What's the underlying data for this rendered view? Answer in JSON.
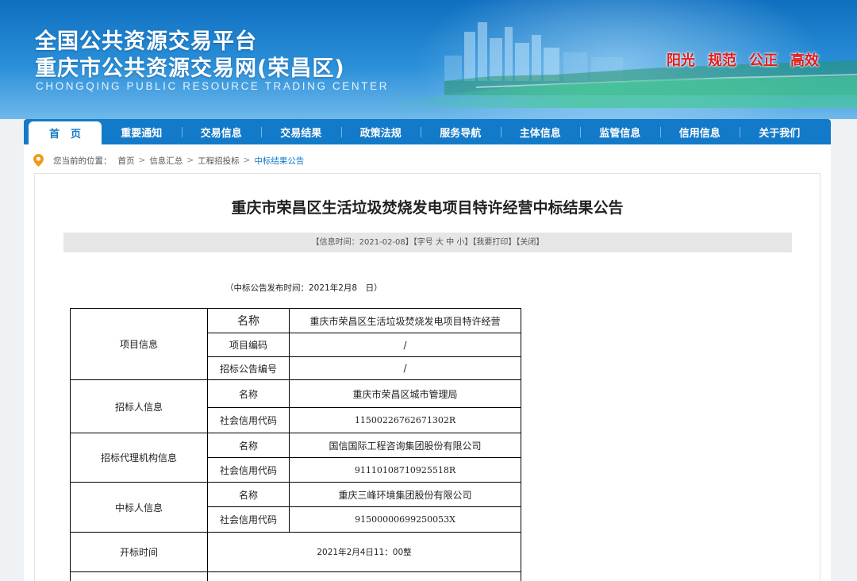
{
  "header": {
    "title_line1": "全国公共资源交易平台",
    "title_line2": "重庆市公共资源交易网(荣昌区)",
    "title_en": "CHONGQING PUBLIC RESOURCE TRADING CENTER",
    "slogans": [
      "阳光",
      "规范",
      "公正",
      "高效"
    ]
  },
  "nav": {
    "items": [
      "首页",
      "重要通知",
      "交易信息",
      "交易结果",
      "政策法规",
      "服务导航",
      "主体信息",
      "监管信息",
      "信用信息",
      "关于我们"
    ]
  },
  "breadcrumb": {
    "prefix": "您当前的位置：",
    "items": [
      "首页",
      "信息汇总",
      "工程招投标",
      "中标结果公告"
    ]
  },
  "article": {
    "title": "重庆市荣昌区生活垃圾焚烧发电项目特许经营中标结果公告",
    "info_time": "【信息时间：2021-02-08】",
    "font_size_label": "【字号",
    "font_large": "大",
    "font_medium": "中",
    "font_small": "小】",
    "print": "【我要打印】",
    "close": "【关闭】",
    "publish_time": "（中标公告发布时间：2021年2月8　日）"
  },
  "table": {
    "project_info": "项目信息",
    "name_label": "名称",
    "project_name": "重庆市荣昌区生活垃圾焚烧发电项目特许经营",
    "project_code_label": "项目编码",
    "project_code": "/",
    "bid_notice_no_label": "招标公告编号",
    "bid_notice_no": "/",
    "tenderer_info": "招标人信息",
    "tenderer_name": "重庆市荣昌区城市管理局",
    "credit_code_label": "社会信用代码",
    "tenderer_code": "11500226762671302R",
    "agency_info": "招标代理机构信息",
    "agency_name": "国信国际工程咨询集团股份有限公司",
    "agency_code": "91110108710925518R",
    "winner_info": "中标人信息",
    "winner_name": "重庆三峰环境集团股份有限公司",
    "winner_code": "91500000699250053X",
    "open_time_label": "开标时间",
    "open_time": "2021年2月4日11：00整"
  },
  "colors": {
    "nav_blue": "#1379c9",
    "slogan_red": "#e21b1b",
    "header_blue": "#0f6fc0"
  },
  "icons": {
    "location": "location-pin-icon"
  }
}
